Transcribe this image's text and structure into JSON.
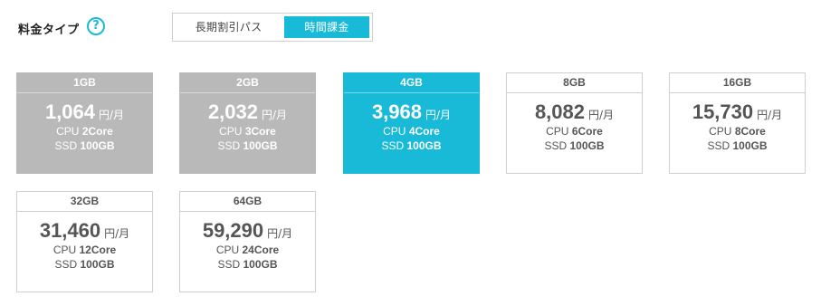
{
  "header": {
    "label": "料金タイプ",
    "help_icon": "?",
    "options": [
      "長期割引パス",
      "時間課金"
    ],
    "selected_option": "時間課金"
  },
  "colors": {
    "accent": "#19b9d8",
    "disabled": "#b9b9b9"
  },
  "plans": [
    {
      "size": "1GB",
      "price": "1,064",
      "unit": "円/月",
      "cpu_label": "CPU",
      "cpu": "2Core",
      "ssd_label": "SSD",
      "ssd": "100GB",
      "state": "disabled"
    },
    {
      "size": "2GB",
      "price": "2,032",
      "unit": "円/月",
      "cpu_label": "CPU",
      "cpu": "3Core",
      "ssd_label": "SSD",
      "ssd": "100GB",
      "state": "disabled"
    },
    {
      "size": "4GB",
      "price": "3,968",
      "unit": "円/月",
      "cpu_label": "CPU",
      "cpu": "4Core",
      "ssd_label": "SSD",
      "ssd": "100GB",
      "state": "selected"
    },
    {
      "size": "8GB",
      "price": "8,082",
      "unit": "円/月",
      "cpu_label": "CPU",
      "cpu": "6Core",
      "ssd_label": "SSD",
      "ssd": "100GB",
      "state": "normal"
    },
    {
      "size": "16GB",
      "price": "15,730",
      "unit": "円/月",
      "cpu_label": "CPU",
      "cpu": "8Core",
      "ssd_label": "SSD",
      "ssd": "100GB",
      "state": "normal"
    },
    {
      "size": "32GB",
      "price": "31,460",
      "unit": "円/月",
      "cpu_label": "CPU",
      "cpu": "12Core",
      "ssd_label": "SSD",
      "ssd": "100GB",
      "state": "normal"
    },
    {
      "size": "64GB",
      "price": "59,290",
      "unit": "円/月",
      "cpu_label": "CPU",
      "cpu": "24Core",
      "ssd_label": "SSD",
      "ssd": "100GB",
      "state": "normal"
    }
  ]
}
